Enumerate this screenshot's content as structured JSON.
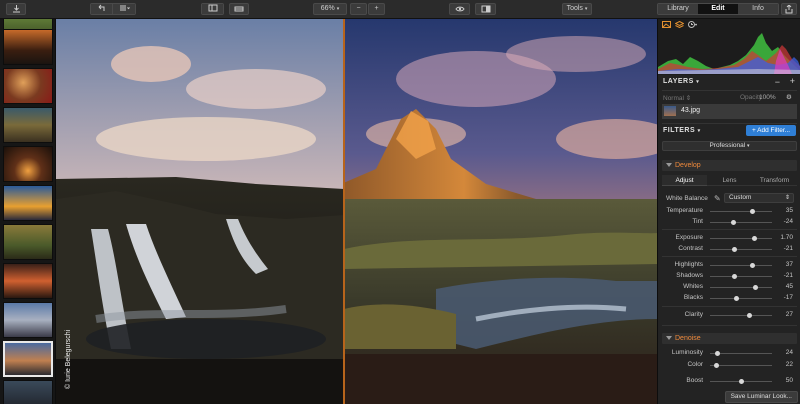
{
  "toolbar": {
    "zoom": "66%",
    "zoom_out": "−",
    "zoom_in": "+",
    "tools": "Tools",
    "tabs": [
      {
        "label": "Library",
        "active": false
      },
      {
        "label": "Edit",
        "active": true
      },
      {
        "label": "Info",
        "active": false
      }
    ]
  },
  "filmstrip": {
    "thumbnail_count": 10,
    "selected_index": 9
  },
  "canvas": {
    "credit": "© Iurie Belegurschi",
    "split_position": 0.477
  },
  "panel": {
    "layers": {
      "title": "LAYERS",
      "blend_mode": "Normal",
      "opacity_label": "Opacity",
      "opacity_value": "100%",
      "layer_name": "43.jpg"
    },
    "filters": {
      "title": "FILTERS",
      "add_button": "+ Add Filter...",
      "workspace": "Professional"
    },
    "develop": {
      "title": "Develop",
      "tabs": [
        "Adjust",
        "Lens",
        "Transform"
      ],
      "white_balance_label": "White Balance",
      "white_balance_value": "Custom",
      "sliders": [
        {
          "label": "Temperature",
          "value": "35",
          "pos": 0.68
        },
        {
          "label": "Tint",
          "value": "-24",
          "pos": 0.38
        },
        {
          "label": "Exposure",
          "value": "1.70",
          "pos": 0.72
        },
        {
          "label": "Contrast",
          "value": "-21",
          "pos": 0.4
        },
        {
          "label": "Highlights",
          "value": "37",
          "pos": 0.69
        },
        {
          "label": "Shadows",
          "value": "-21",
          "pos": 0.4
        },
        {
          "label": "Whites",
          "value": "45",
          "pos": 0.73
        },
        {
          "label": "Blacks",
          "value": "-17",
          "pos": 0.42
        },
        {
          "label": "Clarity",
          "value": "27",
          "pos": 0.63
        }
      ]
    },
    "denoise": {
      "title": "Denoise",
      "sliders": [
        {
          "label": "Luminosity",
          "value": "24",
          "pos": 0.12
        },
        {
          "label": "Color",
          "value": "22",
          "pos": 0.11
        },
        {
          "label": "Boost",
          "value": "50",
          "pos": 0.5
        }
      ]
    },
    "save_look": "Save Luminar Look..."
  },
  "colors": {
    "accent": "#f08a3c",
    "split_line": "#b7641b",
    "add_filter_btn": "#2f7fd6"
  }
}
